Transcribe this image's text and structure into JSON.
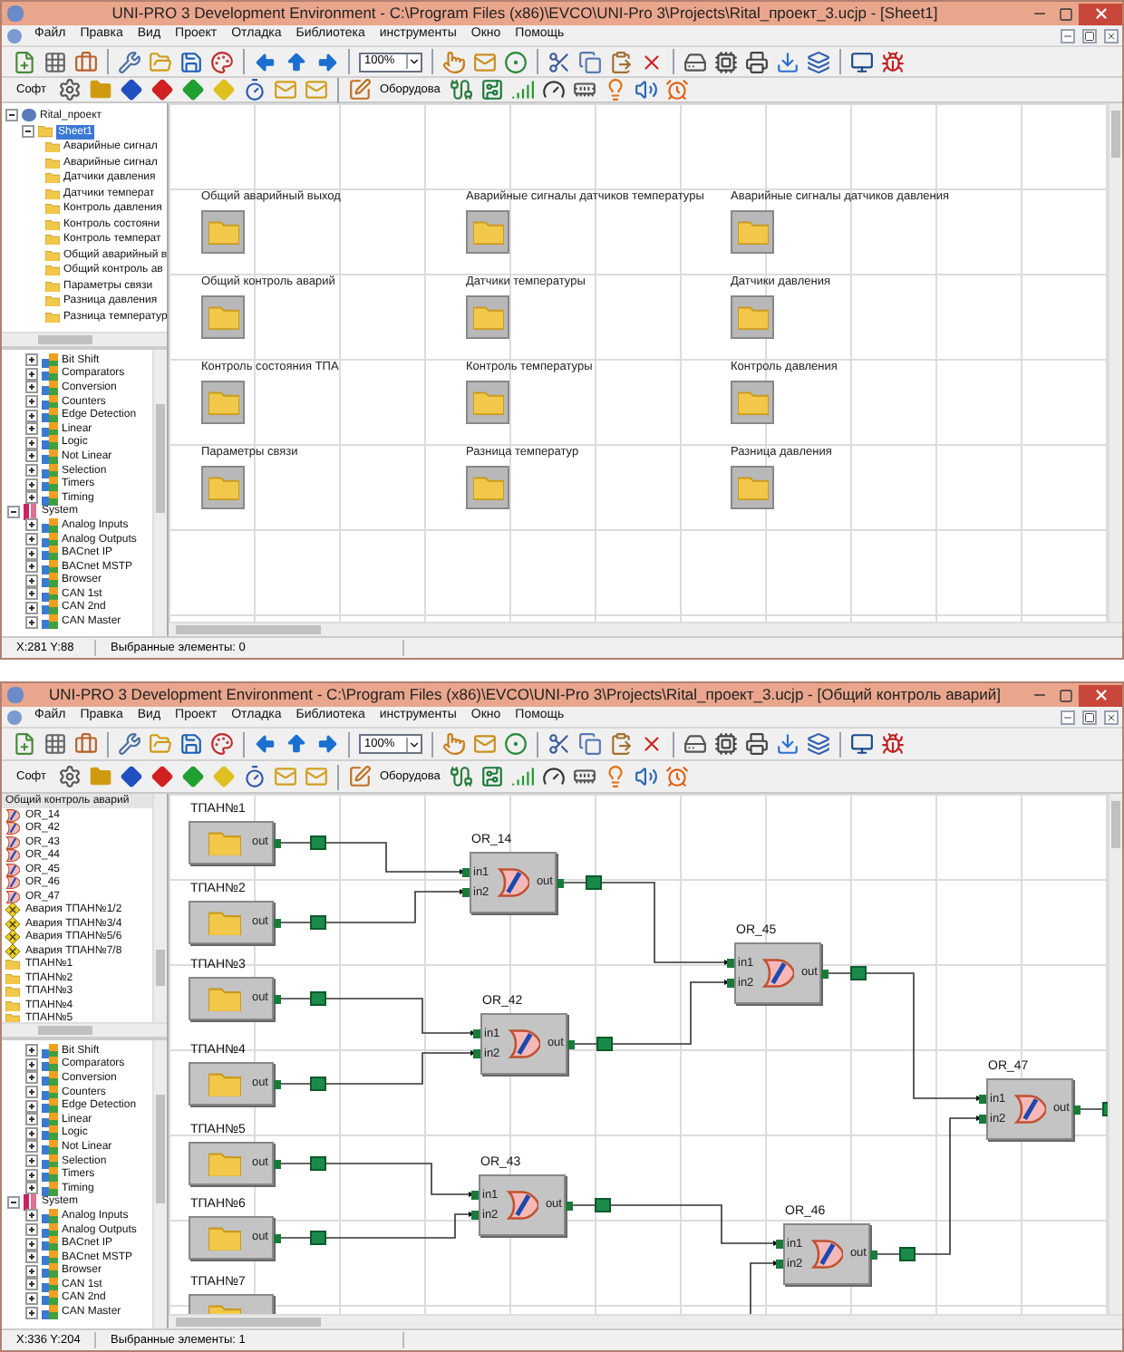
{
  "windows": [
    {
      "title": "UNI-PRO 3 Development Environment - C:\\Program Files (x86)\\EVCO\\UNI-Pro 3\\Projects\\Rital_проект_3.ucjp - [Sheet1]",
      "menu": [
        "Файл",
        "Правка",
        "Вид",
        "Проект",
        "Отладка",
        "Библиотека",
        "инструменты",
        "Окно",
        "Помощь"
      ],
      "zoom": "100%",
      "toolbar_labels": [
        "Софт",
        "Оборудова"
      ],
      "project": {
        "kind": "tree",
        "label": "Rital_проект",
        "expanded": true,
        "children": [
          {
            "label": "Sheet1",
            "expanded": true,
            "selected": true,
            "children": [
              {
                "label": "Аварийные сигнал",
                "selected": false
              },
              {
                "label": "Аварийные сигнал",
                "selected": false
              },
              {
                "label": "Датчики давления",
                "selected": false
              },
              {
                "label": "Датчики температ",
                "selected": false
              },
              {
                "label": "Контроль давления",
                "selected": false
              },
              {
                "label": "Контроль состояни",
                "selected": false
              },
              {
                "label": "Контроль температ",
                "selected": false
              },
              {
                "label": "Общий аварийный в",
                "selected": false
              },
              {
                "label": "Общий контроль ав",
                "selected": false
              },
              {
                "label": "Параметры связи",
                "selected": false
              },
              {
                "label": "Разница давления",
                "selected": false
              },
              {
                "label": "Разница температур",
                "selected": false
              }
            ]
          }
        ]
      },
      "library": [
        {
          "children": [
            {
              "label": "Bit Shift",
              "kind": "block",
              "expanded": false
            },
            {
              "label": "Comparators",
              "kind": "block",
              "expanded": false
            },
            {
              "label": "Conversion",
              "kind": "block",
              "expanded": false
            },
            {
              "label": "Counters",
              "kind": "block",
              "expanded": false
            },
            {
              "label": "Edge Detection",
              "kind": "block",
              "expanded": false
            },
            {
              "label": "Linear",
              "kind": "block",
              "expanded": false
            },
            {
              "label": "Logic",
              "kind": "block",
              "expanded": false
            },
            {
              "label": "Not Linear",
              "kind": "block",
              "expanded": false
            },
            {
              "label": "Selection",
              "kind": "block",
              "expanded": false
            },
            {
              "label": "Timers",
              "kind": "block",
              "expanded": false
            },
            {
              "label": "Timing",
              "kind": "block",
              "expanded": false
            }
          ]
        },
        {
          "label": "System",
          "kind": "group",
          "expanded": true,
          "children": [
            {
              "label": "Analog Inputs",
              "kind": "block",
              "expanded": false
            },
            {
              "label": "Analog Outputs",
              "kind": "block",
              "expanded": false
            },
            {
              "label": "BACnet IP",
              "kind": "block",
              "expanded": false
            },
            {
              "label": "BACnet MSTP",
              "kind": "block",
              "expanded": false
            },
            {
              "label": "Browser",
              "kind": "block",
              "expanded": false
            },
            {
              "label": "CAN 1st",
              "kind": "block",
              "expanded": false
            },
            {
              "label": "CAN 2nd",
              "kind": "block",
              "expanded": false
            },
            {
              "label": "CAN Master",
              "kind": "block",
              "expanded": false
            }
          ]
        }
      ],
      "canvas": {
        "kind": "folders",
        "items": [
          {
            "label": "Общий аварийный выход"
          },
          {
            "label": "Аварийные сигналы датчиков температуры"
          },
          {
            "label": "Аварийные сигналы датчиков давления"
          },
          {
            "label": "Общий контроль аварий"
          },
          {
            "label": "Датчики температуры"
          },
          {
            "label": "Датчики давления"
          },
          {
            "label": "Контроль состояния ТПА"
          },
          {
            "label": "Контроль температуры"
          },
          {
            "label": "Контроль давления"
          },
          {
            "label": "Параметры связи"
          },
          {
            "label": "Разница температур"
          },
          {
            "label": "Разница давления"
          }
        ]
      },
      "status_bar": {
        "coordinates": "X:281 Y:88",
        "selection": "Выбранные элементы: 0"
      }
    },
    {
      "title": "UNI-PRO 3 Development Environment - C:\\Program Files (x86)\\EVCO\\UNI-Pro 3\\Projects\\Rital_проект_3.ucjp - [Общий контроль аварий]",
      "menu": [
        "Файл",
        "Правка",
        "Вид",
        "Проект",
        "Отладка",
        "Библиотека",
        "инструменты",
        "Окно",
        "Помощь"
      ],
      "zoom": "100%",
      "toolbar_labels": [
        "Софт",
        "Оборудова"
      ],
      "project": {
        "kind": "list",
        "header": "Общий контроль аварий",
        "items": [
          {
            "label": "OR_14",
            "kind": "or",
            "selected": false
          },
          {
            "label": "OR_42",
            "kind": "or",
            "selected": false
          },
          {
            "label": "OR_43",
            "kind": "or",
            "selected": false
          },
          {
            "label": "OR_44",
            "kind": "or",
            "selected": false
          },
          {
            "label": "OR_45",
            "kind": "or",
            "selected": false
          },
          {
            "label": "OR_46",
            "kind": "or",
            "selected": false
          },
          {
            "label": "OR_47",
            "kind": "or",
            "selected": false
          },
          {
            "label": "Авария ТПАН№1/2",
            "kind": "alarm",
            "selected": false
          },
          {
            "label": "Авария ТПАН№3/4",
            "kind": "alarm",
            "selected": false
          },
          {
            "label": "Авария ТПАН№5/6",
            "kind": "alarm",
            "selected": false
          },
          {
            "label": "Авария ТПАН№7/8",
            "kind": "alarm",
            "selected": false
          },
          {
            "label": "ТПАН№1",
            "kind": "folder",
            "selected": false
          },
          {
            "label": "ТПАН№2",
            "kind": "folder",
            "selected": false
          },
          {
            "label": "ТПАН№3",
            "kind": "folder",
            "selected": false
          },
          {
            "label": "ТПАН№4",
            "kind": "folder",
            "selected": false
          },
          {
            "label": "ТПАН№5",
            "kind": "folder",
            "selected": false
          }
        ]
      },
      "library": [
        {
          "children": [
            {
              "label": "Bit Shift",
              "kind": "block",
              "expanded": false
            },
            {
              "label": "Comparators",
              "kind": "block",
              "expanded": false
            },
            {
              "label": "Conversion",
              "kind": "block",
              "expanded": false
            },
            {
              "label": "Counters",
              "kind": "block",
              "expanded": false
            },
            {
              "label": "Edge Detection",
              "kind": "block",
              "expanded": false
            },
            {
              "label": "Linear",
              "kind": "block",
              "expanded": false
            },
            {
              "label": "Logic",
              "kind": "block",
              "expanded": false
            },
            {
              "label": "Not Linear",
              "kind": "block",
              "expanded": false
            },
            {
              "label": "Selection",
              "kind": "block",
              "expanded": false
            },
            {
              "label": "Timers",
              "kind": "block",
              "expanded": false
            },
            {
              "label": "Timing",
              "kind": "block",
              "expanded": false
            }
          ]
        },
        {
          "label": "System",
          "kind": "group",
          "expanded": true,
          "children": [
            {
              "label": "Analog Inputs",
              "kind": "block",
              "expanded": false
            },
            {
              "label": "Analog Outputs",
              "kind": "block",
              "expanded": false
            },
            {
              "label": "BACnet IP",
              "kind": "block",
              "expanded": false
            },
            {
              "label": "BACnet MSTP",
              "kind": "block",
              "expanded": false
            },
            {
              "label": "Browser",
              "kind": "block",
              "expanded": false
            },
            {
              "label": "CAN 1st",
              "kind": "block",
              "expanded": false
            },
            {
              "label": "CAN 2nd",
              "kind": "block",
              "expanded": false
            },
            {
              "label": "CAN Master",
              "kind": "block",
              "expanded": false
            }
          ]
        }
      ],
      "canvas": {
        "kind": "diagram",
        "nodes": [
          {
            "label": "ТПАН№1",
            "kind": "folder",
            "output": "out"
          },
          {
            "label": "ТПАН№2",
            "kind": "folder",
            "output": "out"
          },
          {
            "label": "ТПАН№3",
            "kind": "folder",
            "output": "out"
          },
          {
            "label": "ТПАН№4",
            "kind": "folder",
            "output": "out"
          },
          {
            "label": "ТПАН№5",
            "kind": "folder",
            "output": "out"
          },
          {
            "label": "ТПАН№6",
            "kind": "folder",
            "output": "out"
          },
          {
            "label": "ТПАН№7",
            "kind": "folder"
          },
          {
            "label": "OR_14",
            "kind": "or",
            "inputs": [
              "in1",
              "in2"
            ],
            "output": "out"
          },
          {
            "label": "OR_42",
            "kind": "or",
            "inputs": [
              "in1",
              "in2"
            ],
            "output": "out"
          },
          {
            "label": "OR_43",
            "kind": "or",
            "inputs": [
              "in1",
              "in2"
            ],
            "output": "out"
          },
          {
            "label": "OR_45",
            "kind": "or",
            "inputs": [
              "in1",
              "in2"
            ],
            "output": "out"
          },
          {
            "label": "OR_46",
            "kind": "or",
            "inputs": [
              "in1",
              "in2"
            ],
            "output": "out"
          },
          {
            "label": "OR_47",
            "kind": "or",
            "inputs": [
              "in1",
              "in2"
            ],
            "output": "out"
          }
        ]
      },
      "status_bar": {
        "coordinates": "X:336 Y:204",
        "selection": "Выбранные элементы: 1"
      }
    }
  ]
}
